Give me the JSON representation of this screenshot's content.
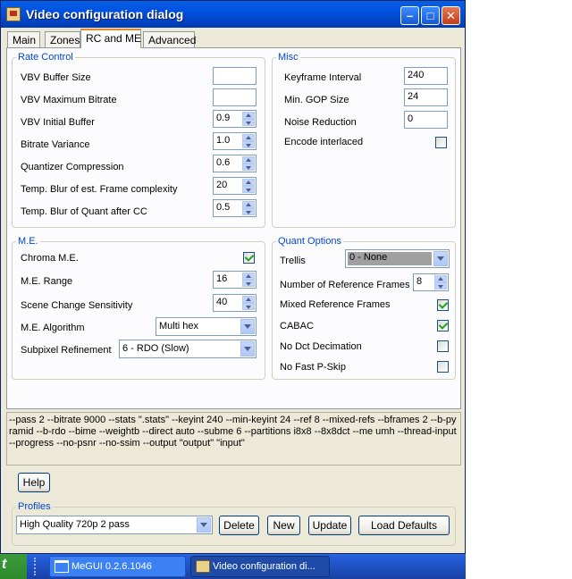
{
  "window": {
    "title": "Video configuration dialog"
  },
  "tabs": [
    "Main",
    "Zones",
    "RC and ME",
    "Advanced"
  ],
  "rate_control": {
    "legend": "Rate Control",
    "vbv_buffer_size": {
      "label": "VBV Buffer Size",
      "value": ""
    },
    "vbv_max_bitrate": {
      "label": "VBV Maximum Bitrate",
      "value": ""
    },
    "vbv_initial_buffer": {
      "label": "VBV Initial Buffer",
      "value": "0.9"
    },
    "bitrate_variance": {
      "label": "Bitrate Variance",
      "value": "1.0"
    },
    "quantizer_compression": {
      "label": "Quantizer Compression",
      "value": "0.6"
    },
    "temp_blur_frame": {
      "label": "Temp. Blur of est. Frame complexity",
      "value": "20"
    },
    "temp_blur_quant": {
      "label": "Temp. Blur of Quant after CC",
      "value": "0.5"
    }
  },
  "misc": {
    "legend": "Misc",
    "keyframe_interval": {
      "label": "Keyframe Interval",
      "value": "240"
    },
    "min_gop_size": {
      "label": "Min. GOP Size",
      "value": "24"
    },
    "noise_reduction": {
      "label": "Noise Reduction",
      "value": "0"
    },
    "encode_interlaced": {
      "label": "Encode interlaced",
      "checked": false
    }
  },
  "me": {
    "legend": "M.E.",
    "chroma_me": {
      "label": "Chroma M.E.",
      "checked": true
    },
    "me_range": {
      "label": "M.E. Range",
      "value": "16"
    },
    "scene_change": {
      "label": "Scene Change Sensitivity",
      "value": "40"
    },
    "me_algorithm": {
      "label": "M.E. Algorithm",
      "value": "Multi hex"
    },
    "subpixel_refinement": {
      "label": "Subpixel Refinement",
      "value": "6 - RDO (Slow)"
    }
  },
  "quant": {
    "legend": "Quant Options",
    "trellis": {
      "label": "Trellis",
      "value": "0 - None"
    },
    "ref_frames": {
      "label": "Number of Reference Frames",
      "value": "8"
    },
    "mixed_ref": {
      "label": "Mixed Reference Frames",
      "checked": true
    },
    "cabac": {
      "label": "CABAC",
      "checked": true
    },
    "no_dct_decimation": {
      "label": "No Dct Decimation",
      "checked": false
    },
    "no_fast_pskip": {
      "label": "No Fast P-Skip",
      "checked": false
    }
  },
  "command_line": "--pass 2 --bitrate 9000 --stats \".stats\" --keyint 240 --min-keyint 24 --ref 8 --mixed-refs --bframes 2 --b-pyramid --b-rdo --bime --weightb --direct auto --subme 6 --partitions i8x8 --8x8dct --me umh --thread-input --progress --no-psnr --no-ssim --output \"output\" \"input\"",
  "help_label": "Help",
  "profiles": {
    "legend": "Profiles",
    "selected": "High Quality 720p 2 pass",
    "delete_label": "Delete",
    "new_label": "New",
    "update_label": "Update",
    "load_defaults_label": "Load Defaults"
  },
  "taskbar": {
    "start_label": "t",
    "items": [
      "MeGUI 0.2.6.1046",
      "Video configuration di..."
    ]
  }
}
